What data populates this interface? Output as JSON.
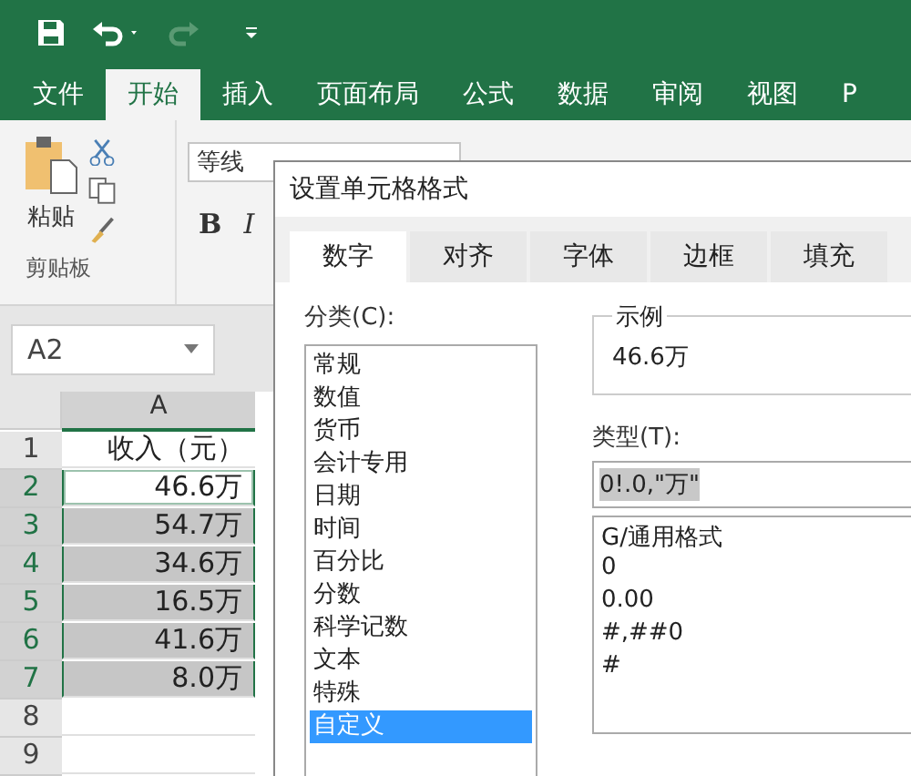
{
  "ribbon_tabs": [
    {
      "label": "文件",
      "selected": false
    },
    {
      "label": "开始",
      "selected": true
    },
    {
      "label": "插入",
      "selected": false
    },
    {
      "label": "页面布局",
      "selected": false
    },
    {
      "label": "公式",
      "selected": false
    },
    {
      "label": "数据",
      "selected": false
    },
    {
      "label": "审阅",
      "selected": false
    },
    {
      "label": "视图",
      "selected": false
    },
    {
      "label": "P",
      "selected": false
    }
  ],
  "clipboard": {
    "paste_label": "粘贴",
    "group_label": "剪贴板"
  },
  "font": {
    "name": "等线",
    "bold": "B",
    "italic": "I"
  },
  "name_box": {
    "value": "A2"
  },
  "sheet": {
    "column": "A",
    "rows": [
      {
        "number": "1",
        "value": "收入（元）",
        "selected": false,
        "active": false
      },
      {
        "number": "2",
        "value": "46.6万",
        "selected": true,
        "active": true
      },
      {
        "number": "3",
        "value": "54.7万",
        "selected": true,
        "active": false
      },
      {
        "number": "4",
        "value": "34.6万",
        "selected": true,
        "active": false
      },
      {
        "number": "5",
        "value": "16.5万",
        "selected": true,
        "active": false
      },
      {
        "number": "6",
        "value": "41.6万",
        "selected": true,
        "active": false
      },
      {
        "number": "7",
        "value": "8.0万",
        "selected": true,
        "active": false
      },
      {
        "number": "8",
        "value": "",
        "selected": false,
        "active": false
      },
      {
        "number": "9",
        "value": "",
        "selected": false,
        "active": false
      }
    ]
  },
  "dialog": {
    "title": "设置单元格格式",
    "tabs": [
      {
        "label": "数字",
        "selected": true
      },
      {
        "label": "对齐",
        "selected": false
      },
      {
        "label": "字体",
        "selected": false
      },
      {
        "label": "边框",
        "selected": false
      },
      {
        "label": "填充",
        "selected": false
      }
    ],
    "category_label": "分类(C):",
    "categories": [
      {
        "label": "常规",
        "selected": false
      },
      {
        "label": "数值",
        "selected": false
      },
      {
        "label": "货币",
        "selected": false
      },
      {
        "label": "会计专用",
        "selected": false
      },
      {
        "label": "日期",
        "selected": false
      },
      {
        "label": "时间",
        "selected": false
      },
      {
        "label": "百分比",
        "selected": false
      },
      {
        "label": "分数",
        "selected": false
      },
      {
        "label": "科学记数",
        "selected": false
      },
      {
        "label": "文本",
        "selected": false
      },
      {
        "label": "特殊",
        "selected": false
      },
      {
        "label": "自定义",
        "selected": true
      }
    ],
    "sample_label": "示例",
    "sample_value": "46.6万",
    "type_label": "类型(T):",
    "type_value": "0!.0,\"万\"",
    "formats": [
      "G/通用格式",
      "0",
      "0.00",
      "#,##0",
      "#"
    ]
  }
}
